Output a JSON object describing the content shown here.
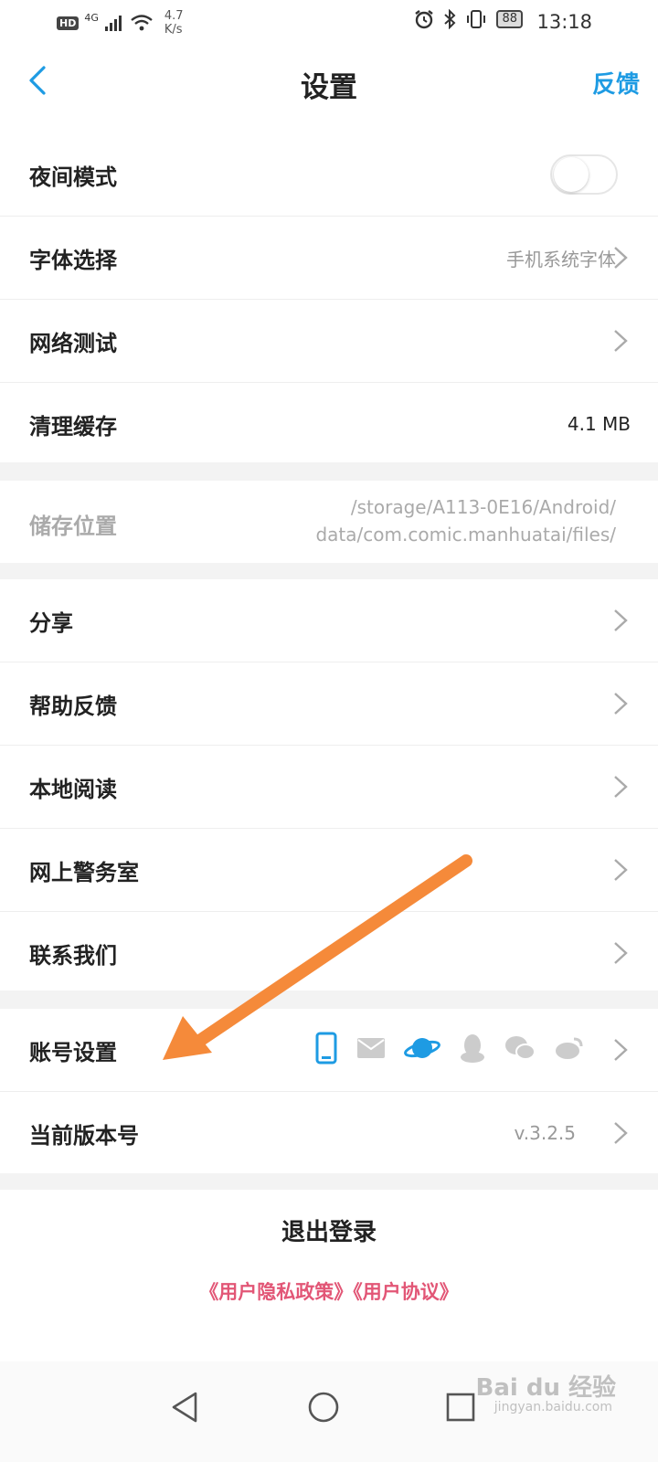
{
  "status_bar": {
    "hd": "HD",
    "network": "4G",
    "speed_value": "4.7",
    "speed_unit": "K/s",
    "battery": "88",
    "time": "13:18"
  },
  "header": {
    "title": "设置",
    "feedback": "反馈",
    "back_icon": "chevron-left-icon"
  },
  "settings": {
    "night_mode": {
      "label": "夜间模式",
      "enabled": false
    },
    "font": {
      "label": "字体选择",
      "value": "手机系统字体"
    },
    "network_test": {
      "label": "网络测试"
    },
    "clear_cache": {
      "label": "清理缓存",
      "value": "4.1 MB"
    },
    "storage": {
      "label": "储存位置",
      "path_line1": "/storage/A113-0E16/Android/",
      "path_line2": "data/com.comic.manhuatai/files/"
    },
    "share": {
      "label": "分享"
    },
    "help": {
      "label": "帮助反馈"
    },
    "local_read": {
      "label": "本地阅读"
    },
    "police": {
      "label": "网上警务室"
    },
    "contact": {
      "label": "联系我们"
    },
    "account": {
      "label": "账号设置",
      "icons": [
        "phone-icon",
        "mail-icon",
        "planet-icon",
        "qq-icon",
        "wechat-icon",
        "weibo-icon"
      ]
    },
    "version": {
      "label": "当前版本号",
      "value": "v.3.2.5"
    }
  },
  "footer": {
    "logout": "退出登录",
    "policy": "《用户隐私政策》《用户协议》"
  },
  "watermark": {
    "brand": "Bai du 经验",
    "url": "jingyan.baidu.com"
  },
  "colors": {
    "accent": "#1e9be3",
    "policy": "#e25676",
    "annotation_arrow": "#f58a3a"
  }
}
